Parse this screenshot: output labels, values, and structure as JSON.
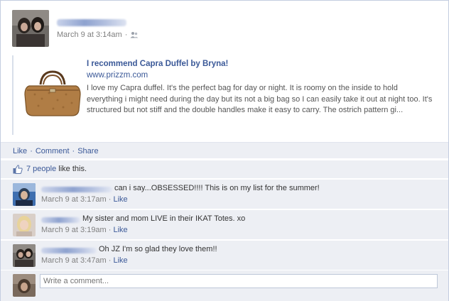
{
  "post": {
    "timestamp": "March 9 at 3:14am",
    "dot": "·",
    "audience_icon": "friends-icon"
  },
  "attachment": {
    "title": "I recommend Capra Duffel by Bryna!",
    "url": "www.prizzm.com",
    "description": "I love my Capra duffel. It's the perfect bag for day or night. It is roomy on the inside to hold everything i might need during the day but its not a big bag so I can easily take it out at night too. It's structured but not stiff and the double handles make it easy to carry. The ostrich pattern gi..."
  },
  "actions": {
    "like": "Like",
    "comment": "Comment",
    "share": "Share",
    "sep": "·"
  },
  "likes": {
    "count": "7 people",
    "suffix": " like this."
  },
  "comments": [
    {
      "text": "can i say...OBSESSED!!!! This is on my list for the summer!",
      "time": "March 9 at 3:17am",
      "like": "Like"
    },
    {
      "text": "My sister and mom LIVE in their IKAT Totes. xo",
      "time": "March 9 at 3:19am",
      "like": "Like"
    },
    {
      "text": "Oh JZ I'm so glad they love them!!",
      "time": "March 9 at 3:47am",
      "like": "Like"
    }
  ],
  "comment_meta_sep": " · ",
  "write_comment": {
    "placeholder": "Write a comment..."
  },
  "colors": {
    "link": "#3b5998",
    "panel": "#edeff4",
    "meta": "#808080"
  }
}
